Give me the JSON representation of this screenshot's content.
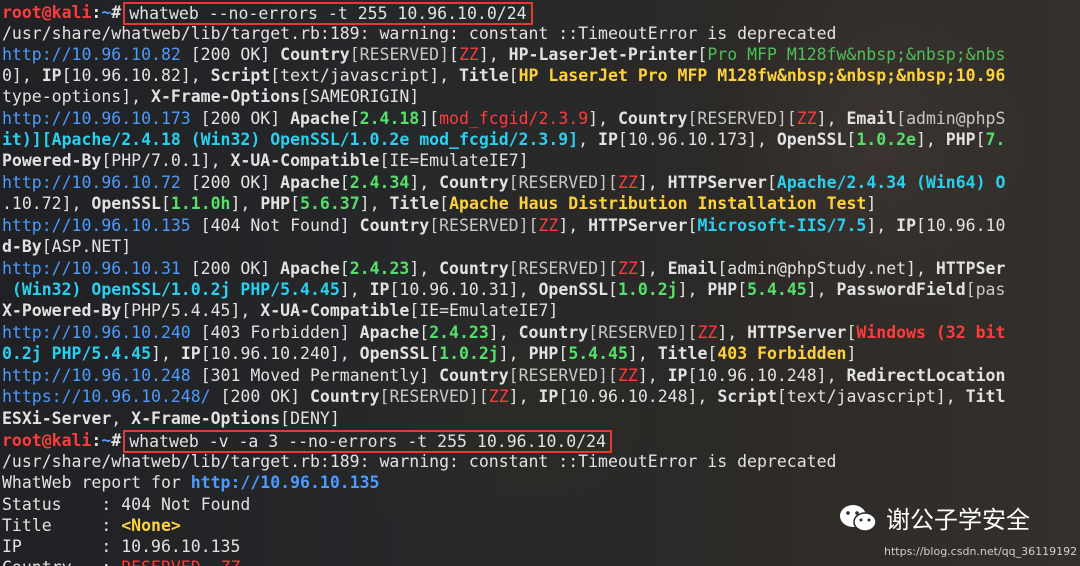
{
  "prompt": {
    "user": "root@kali",
    "sep": ":",
    "path": "~",
    "symbol": "#"
  },
  "cmd1": "whatweb --no-errors -t 255 10.96.10.0/24",
  "warn1": "/usr/share/whatweb/lib/target.rb:189: warning: constant ::TimeoutError is deprecated",
  "l3": {
    "url": "http://10.96.10.82",
    "status": " [200 OK] ",
    "k1": "Country",
    "v1": "[RESERVED]",
    "p1": "[",
    "cc": "ZZ",
    "p2": "], ",
    "k2": "HP-LaserJet-Printer",
    "p3": "[",
    "v2": "Pro MFP M128fw&nbsp;&nbsp;&nbs"
  },
  "l4": {
    "pre": "0], ",
    "k1": "IP",
    "v1": "[10.96.10.82], ",
    "k2": "Script",
    "v2": "[text/javascript], ",
    "k3": "Title",
    "p1": "[",
    "v3": "HP LaserJet Pro MFP M128fw&nbsp;&nbsp;&nbsp;10.96"
  },
  "l5": {
    "pre": "type-options], ",
    "k1": "X-Frame-Options",
    "v1": "[SAMEORIGIN]"
  },
  "l6": {
    "url": "http://10.96.10.173",
    "status": " [200 OK] ",
    "k1": "Apache",
    "p1": "[",
    "v1": "2.4.18",
    "p2": "][",
    "v2": "mod_fcgid/2.3.9",
    "p3": "], ",
    "k2": "Country",
    "v3": "[RESERVED][",
    "cc": "ZZ",
    "p4": "], ",
    "k3": "Email",
    "v4": "[admin@phpS"
  },
  "l7": {
    "v1": "it)][Apache/2.4.18 (Win32) OpenSSL/1.0.2e mod_fcgid/2.3.9]",
    "p1": ", ",
    "k1": "IP",
    "v2": "[10.96.10.173], ",
    "k2": "OpenSSL",
    "p2": "[",
    "v3": "1.0.2e",
    "p3": "], ",
    "k3": "PHP",
    "p4": "[",
    "v4": "7."
  },
  "l8": {
    "k1": "Powered-By",
    "v1": "[PHP/7.0.1], ",
    "k2": "X-UA-Compatible",
    "v2": "[IE=EmulateIE7]"
  },
  "l9": {
    "url": "http://10.96.10.72",
    "status": " [200 OK] ",
    "k1": "Apache",
    "p1": "[",
    "v1": "2.4.34",
    "p2": "], ",
    "k2": "Country",
    "v2": "[RESERVED][",
    "cc": "ZZ",
    "p3": "], ",
    "k3": "HTTPServer",
    "p4": "[",
    "v3": "Apache/2.4.34 (Win64) O"
  },
  "l10": {
    "pre": ".10.72], ",
    "k1": "OpenSSL",
    "p1": "[",
    "v1": "1.1.0h",
    "p2": "], ",
    "k2": "PHP",
    "p3": "[",
    "v2": "5.6.37",
    "p4": "], ",
    "k3": "Title",
    "p5": "[",
    "v3": "Apache Haus Distribution Installation Test",
    "p6": "]"
  },
  "l11": {
    "url": "http://10.96.10.135",
    "status": " [404 Not Found] ",
    "k1": "Country",
    "v1": "[RESERVED][",
    "cc": "ZZ",
    "p1": "], ",
    "k2": "HTTPServer",
    "p2": "[",
    "v2": "Microsoft-IIS/7.5",
    "p3": "], ",
    "k3": "IP",
    "v3": "[10.96.10"
  },
  "l12": {
    "k1": "d-By",
    "v1": "[ASP.NET]"
  },
  "l13": {
    "url": "http://10.96.10.31",
    "status": " [200 OK] ",
    "k1": "Apache",
    "p1": "[",
    "v1": "2.4.23",
    "p2": "], ",
    "k2": "Country",
    "v2": "[RESERVED][",
    "cc": "ZZ",
    "p3": "], ",
    "k3": "Email",
    "v3": "[admin@phpStudy.net], ",
    "k4": "HTTPSer"
  },
  "l14": {
    "v1": " (Win32) OpenSSL/1.0.2j PHP/5.4.45",
    "p1": "], ",
    "k1": "IP",
    "v2": "[10.96.10.31], ",
    "k2": "OpenSSL",
    "p2": "[",
    "v3": "1.0.2j",
    "p3": "], ",
    "k3": "PHP",
    "p4": "[",
    "v4": "5.4.45",
    "p5": "], ",
    "k4": "PasswordField",
    "v5": "[pas"
  },
  "l15": {
    "k1": "X-Powered-By",
    "v1": "[PHP/5.4.45], ",
    "k2": "X-UA-Compatible",
    "v2": "[IE=EmulateIE7]"
  },
  "l16": {
    "url": "http://10.96.10.240",
    "status": " [403 Forbidden] ",
    "k1": "Apache",
    "p1": "[",
    "v1": "2.4.23",
    "p2": "], ",
    "k2": "Country",
    "v2": "[RESERVED][",
    "cc": "ZZ",
    "p3": "], ",
    "k3": "HTTPServer",
    "p4": "[",
    "v3": "Windows (32 bit"
  },
  "l17": {
    "v1": "0.2j PHP/5.4.45",
    "p1": "], ",
    "k1": "IP",
    "v2": "[10.96.10.240], ",
    "k2": "OpenSSL",
    "p2": "[",
    "v3": "1.0.2j",
    "p3": "], ",
    "k3": "PHP",
    "p4": "[",
    "v4": "5.4.45",
    "p5": "], ",
    "k4": "Title",
    "p6": "[",
    "v5": "403 Forbidden",
    "p7": "]"
  },
  "l18": {
    "url": "http://10.96.10.248",
    "status": " [301 Moved Permanently] ",
    "k1": "Country",
    "v1": "[RESERVED][",
    "cc": "ZZ",
    "p1": "], ",
    "k2": "IP",
    "v2": "[10.96.10.248], ",
    "k3": "RedirectLocation"
  },
  "l19": {
    "url": "https://10.96.10.248/",
    "status": " [200 OK] ",
    "k1": "Country",
    "v1": "[RESERVED][",
    "cc": "ZZ",
    "p1": "], ",
    "k2": "IP",
    "v2": "[10.96.10.248], ",
    "k3": "Script",
    "v3": "[text/javascript], ",
    "k4": "Titl"
  },
  "l20": {
    "k1": "ESXi-Server",
    "p1": ", ",
    "k2": "X-Frame-Options",
    "v1": "[DENY]"
  },
  "cmd2": "whatweb -v -a 3 --no-errors -t 255 10.96.10.0/24",
  "warn2": "/usr/share/whatweb/lib/target.rb:189: warning: constant ::TimeoutError is deprecated",
  "report": {
    "label": "WhatWeb report for ",
    "url": "http://10.96.10.135"
  },
  "status_row": {
    "key": "Status",
    "sep": "    : ",
    "value": "404 Not Found"
  },
  "title_row": {
    "key": "Title",
    "sep": "     : ",
    "value": "<None>"
  },
  "ip_row": {
    "key": "IP",
    "sep": "        : ",
    "value": "10.96.10.135"
  },
  "country_row": {
    "key": "Country",
    "sep": "   : ",
    "value": "RESERVED, ZZ"
  },
  "watermark": {
    "name": "谢公子学安全",
    "url": "https://blog.csdn.net/qq_36119192"
  }
}
